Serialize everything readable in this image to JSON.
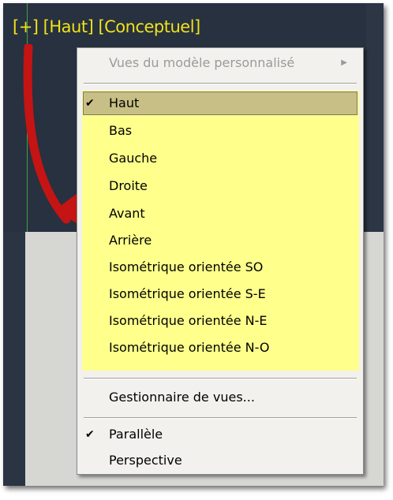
{
  "viewport_label": {
    "plus": "[+]",
    "view": "[Haut]",
    "style": "[Conceptuel]"
  },
  "menu": {
    "submenu_label": "Vues du modèle personnalisé",
    "views": [
      {
        "label": "Haut",
        "checked": true
      },
      {
        "label": "Bas",
        "checked": false
      },
      {
        "label": "Gauche",
        "checked": false
      },
      {
        "label": "Droite",
        "checked": false
      },
      {
        "label": "Avant",
        "checked": false
      },
      {
        "label": "Arrière",
        "checked": false
      },
      {
        "label": "Isométrique orientée SO",
        "checked": false
      },
      {
        "label": "Isométrique orientée S-E",
        "checked": false
      },
      {
        "label": "Isométrique orientée N-E",
        "checked": false
      },
      {
        "label": "Isométrique orientée N-O",
        "checked": false
      }
    ],
    "view_manager_label": "Gestionnaire de vues...",
    "projection": [
      {
        "label": "Parallèle",
        "checked": true
      },
      {
        "label": "Perspective",
        "checked": false
      }
    ],
    "check_glyph": "✔",
    "submenu_glyph": "▶"
  },
  "colors": {
    "label_yellow": "#f0e21a",
    "highlight_yellow": "#ffff8c",
    "arrow_red": "#c41414",
    "viewport_dark": "#27313f"
  }
}
